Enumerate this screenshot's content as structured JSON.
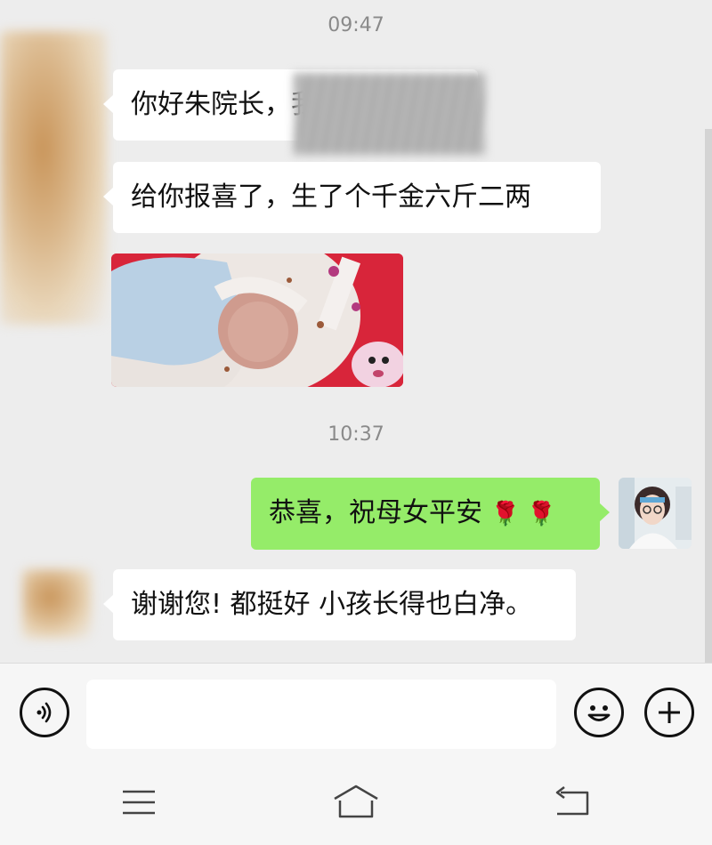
{
  "chat": {
    "time_1": "09:47",
    "msg_1": "你好朱院长，我是",
    "msg_2": "给你报喜了，生了个千金六斤二两",
    "photo_description": "photo",
    "time_2": "10:37",
    "msg_3": "恭喜，祝母女平安",
    "msg_3_emoji": "🌹 🌹",
    "msg_4": "谢谢您! 都挺好 小孩长得也白净。"
  },
  "colors": {
    "background": "#ededed",
    "my_bubble": "#95ec69",
    "their_bubble": "#ffffff",
    "time_text": "#8a8a8a"
  },
  "icons": {
    "voice": "voice-icon",
    "emoji": "emoji-icon",
    "plus": "plus-icon",
    "menu": "menu-icon",
    "home": "home-icon",
    "back": "back-icon"
  }
}
